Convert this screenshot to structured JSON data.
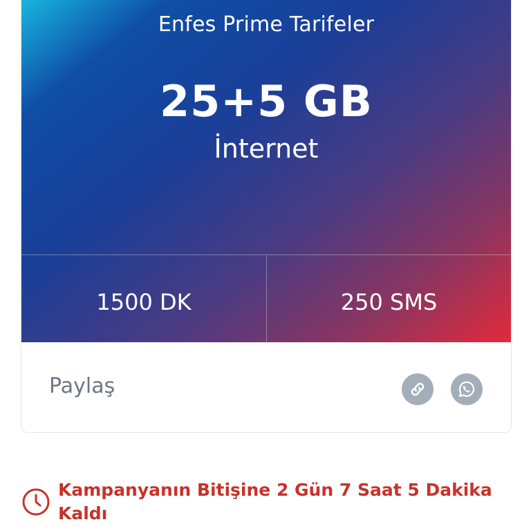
{
  "tariff": {
    "title": "Enfes Prime Tarifeler",
    "data_amount": "25+5 GB",
    "data_label": "İnternet",
    "minutes": "1500 DK",
    "sms": "250 SMS"
  },
  "share": {
    "label": "Paylaş",
    "buttons": [
      {
        "icon": "link-icon"
      },
      {
        "icon": "whatsapp-icon"
      }
    ]
  },
  "campaign": {
    "countdown_text": "Kampanyanın Bitişine 2 Gün 7 Saat 5 Dakika Kaldı",
    "icon": "clock-icon"
  },
  "colors": {
    "gradient_start": "#18b6de",
    "gradient_mid": "#1a3f98",
    "gradient_end": "#e32a3a",
    "share_button": "#a3aeba",
    "countdown_red": "#c8322a"
  }
}
